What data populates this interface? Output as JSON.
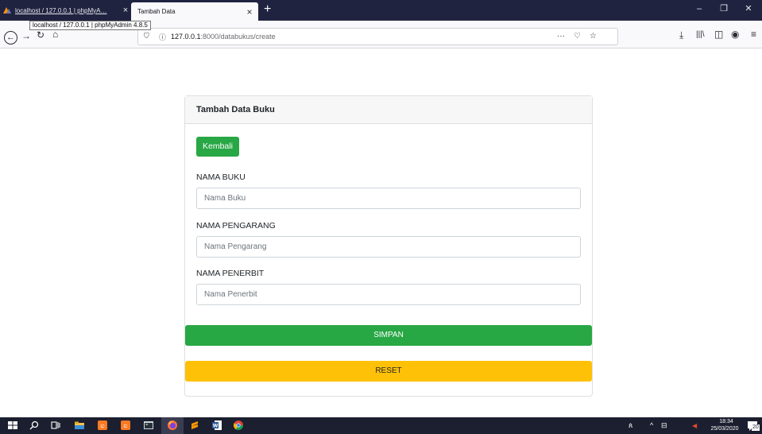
{
  "browser": {
    "tabs": [
      {
        "label": "localhost / 127.0.0.1 | phpMyA…",
        "close": "×"
      },
      {
        "label": "Tambah Data",
        "close": "×"
      }
    ],
    "new_tab": "+",
    "window_controls": {
      "minimize": "–",
      "restore": "❐",
      "close": "✕"
    },
    "tooltip": "localhost / 127.0.0.1 | phpMyAdmin 4.8.5",
    "url": {
      "host": "127.0.0.1",
      "path": ":8000/databukus/create"
    },
    "nav_icons": [
      "back-icon",
      "forward-icon",
      "reload-icon",
      "home-icon",
      "shield-icon",
      "info-icon",
      "more-icon",
      "pocket-icon",
      "bookmark-star-icon",
      "download-icon",
      "library-icon",
      "sidebar-icon",
      "account-icon",
      "menu-icon"
    ]
  },
  "page": {
    "card_title": "Tambah Data Buku",
    "back_button": "Kembali",
    "fields": [
      {
        "label": "NAMA BUKU",
        "placeholder": "Nama Buku"
      },
      {
        "label": "NAMA PENGARANG",
        "placeholder": "Nama Pengarang"
      },
      {
        "label": "NAMA PENERBIT",
        "placeholder": "Nama Penerbit"
      }
    ],
    "submit_button": "SIMPAN",
    "reset_button": "RESET",
    "colors": {
      "success": "#28a745",
      "warning": "#ffc107"
    }
  },
  "taskbar": {
    "time": "18:34",
    "date": "25/03/2020",
    "notification_count": "20",
    "icons": [
      "windows-start-icon",
      "search-icon",
      "task-view-icon",
      "file-explorer-icon",
      "xampp-icon",
      "xampp-icon",
      "terminal-icon",
      "firefox-icon",
      "sublime-text-icon",
      "word-icon",
      "chrome-icon"
    ]
  }
}
